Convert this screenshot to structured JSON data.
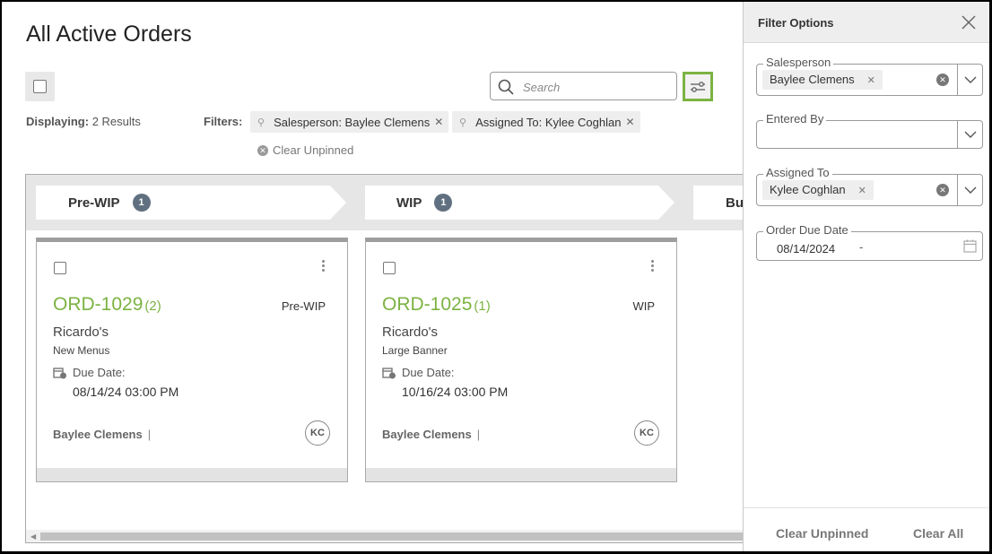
{
  "page": {
    "title": "All Active Orders",
    "search_placeholder": "Search",
    "displaying_label": "Displaying:",
    "displaying_value": "2 Results",
    "filters_label": "Filters:",
    "filter_chips": [
      {
        "label": "Salesperson: Baylee Clemens"
      },
      {
        "label": "Assigned To: Kylee Coghlan"
      }
    ],
    "clear_unpinned": "Clear Unpinned"
  },
  "board": {
    "stages": [
      {
        "name": "Pre-WIP",
        "count": "1"
      },
      {
        "name": "WIP",
        "count": "1"
      },
      {
        "name": "Bu"
      }
    ],
    "cards": [
      {
        "order_no": "ORD-1029",
        "count": "(2)",
        "stage": "Pre-WIP",
        "customer": "Ricardo's",
        "description": "New Menus",
        "due_label": "Due Date:",
        "due_date": "08/14/24 03:00 PM",
        "salesperson": "Baylee Clemens",
        "separator": "|",
        "avatar": "KC"
      },
      {
        "order_no": "ORD-1025",
        "count": "(1)",
        "stage": "WIP",
        "customer": "Ricardo's",
        "description": "Large Banner",
        "due_label": "Due Date:",
        "due_date": "10/16/24 03:00 PM",
        "salesperson": "Baylee Clemens",
        "separator": "|",
        "avatar": "KC"
      }
    ]
  },
  "panel": {
    "title": "Filter Options",
    "fields": [
      {
        "label": "Salesperson",
        "value": "Baylee Clemens"
      },
      {
        "label": "Entered By",
        "value": ""
      },
      {
        "label": "Assigned To",
        "value": "Kylee Coghlan"
      },
      {
        "label": "Order Due Date",
        "value": "08/14/2024",
        "separator": "-"
      }
    ],
    "clear_unpinned": "Clear Unpinned",
    "clear_all": "Clear All"
  },
  "colors": {
    "accent_green": "#7cb342",
    "stage_badge": "#607080"
  },
  "icons": [
    "search-icon",
    "filter-sliders-icon",
    "pin-icon",
    "close-icon",
    "chevron-down-icon",
    "calendar-icon",
    "more-vertical-icon"
  ]
}
